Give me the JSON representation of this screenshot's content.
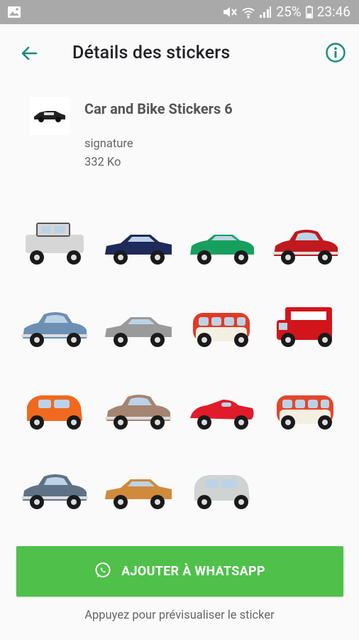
{
  "status_bar": {
    "battery": "25%",
    "time": "23:46"
  },
  "header": {
    "title": "Détails des stickers"
  },
  "pack": {
    "name": "Car and Bike Stickers 6",
    "author": "signature",
    "size": "332 Ko"
  },
  "stickers": [
    {
      "color": "#d6d6d6",
      "kind": "jeep"
    },
    {
      "color": "#1e2a5a",
      "kind": "sedan"
    },
    {
      "color": "#17a05d",
      "kind": "coupe"
    },
    {
      "color": "#c0191e",
      "kind": "classic"
    },
    {
      "color": "#6c8fb3",
      "kind": "classic"
    },
    {
      "color": "#9a9a9a",
      "kind": "sedan"
    },
    {
      "color": "#e03a25",
      "kind": "van"
    },
    {
      "color": "#d1151b",
      "kind": "truck"
    },
    {
      "color": "#ef6a1e",
      "kind": "mini"
    },
    {
      "color": "#a48572",
      "kind": "classic"
    },
    {
      "color": "#e01b2a",
      "kind": "racer"
    },
    {
      "color": "#e2482c",
      "kind": "van"
    },
    {
      "color": "#5e7286",
      "kind": "classic"
    },
    {
      "color": "#d08a3c",
      "kind": "sedan"
    },
    {
      "color": "#cfd3d1",
      "kind": "mini"
    }
  ],
  "actions": {
    "add_label": "AJOUTER À WHATSAPP",
    "hint": "Appuyez pour prévisualiser le sticker"
  },
  "colors": {
    "accent": "#128c7e",
    "button": "#4fc04a"
  }
}
